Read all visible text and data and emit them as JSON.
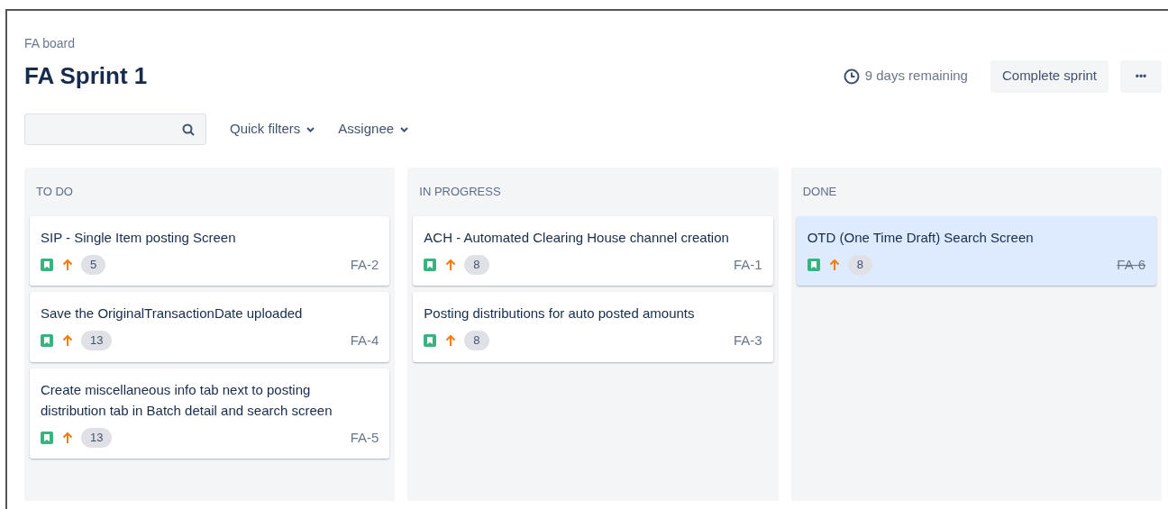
{
  "breadcrumb": "FA board",
  "title": "FA Sprint 1",
  "remaining": "9 days remaining",
  "complete_button": "Complete sprint",
  "more_button": "•••",
  "filters": [
    {
      "label": "Quick filters"
    },
    {
      "label": "Assignee"
    }
  ],
  "columns": [
    {
      "name": "TO DO",
      "cards": [
        {
          "summary": "SIP - Single Item posting Screen",
          "points": "5",
          "key": "FA-2",
          "selected": false,
          "resolved": false
        },
        {
          "summary": "Save the OriginalTransactionDate uploaded",
          "points": "13",
          "key": "FA-4",
          "selected": false,
          "resolved": false
        },
        {
          "summary": "Create miscellaneous info tab next to posting distribution tab in Batch detail and search screen",
          "points": "13",
          "key": "FA-5",
          "selected": false,
          "resolved": false
        }
      ]
    },
    {
      "name": "IN PROGRESS",
      "cards": [
        {
          "summary": "ACH - Automated Clearing House channel creation",
          "points": "8",
          "key": "FA-1",
          "selected": false,
          "resolved": false
        },
        {
          "summary": "Posting distributions for auto posted amounts",
          "points": "8",
          "key": "FA-3",
          "selected": false,
          "resolved": false
        }
      ]
    },
    {
      "name": "DONE",
      "cards": [
        {
          "summary": "OTD (One Time Draft) Search Screen",
          "points": "8",
          "key": "FA-6",
          "selected": true,
          "resolved": true
        }
      ]
    }
  ]
}
